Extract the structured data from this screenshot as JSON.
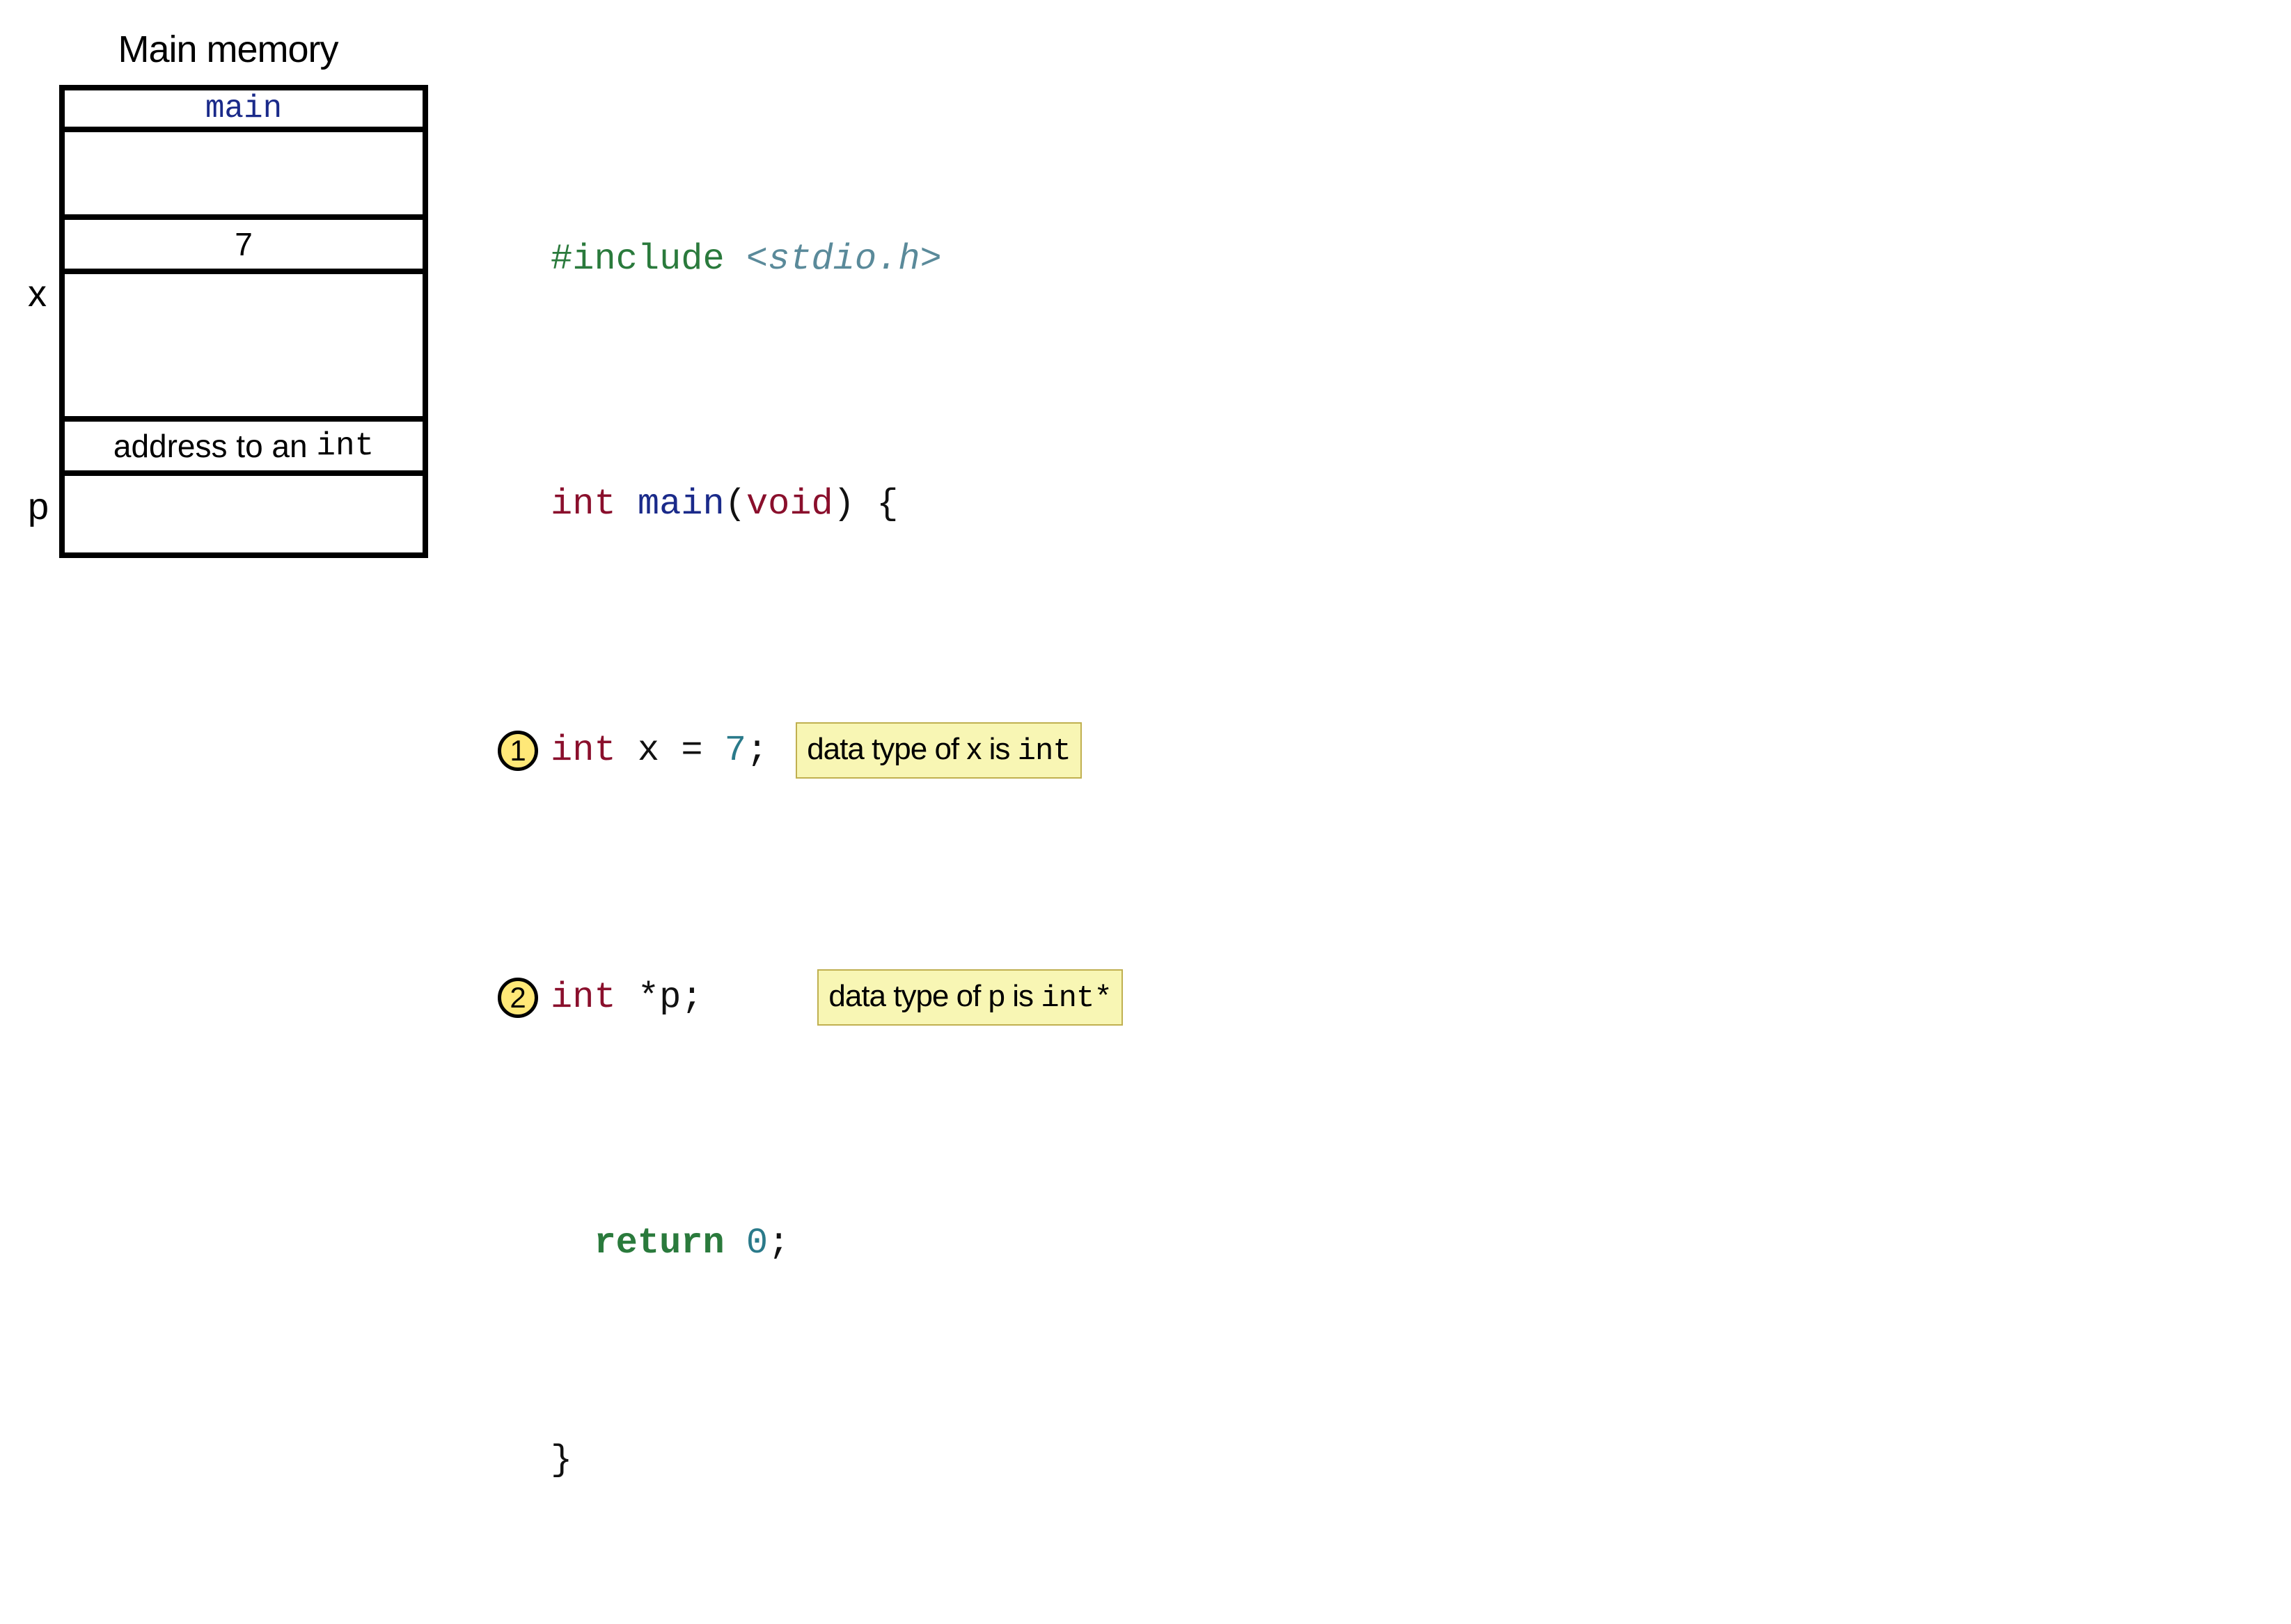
{
  "memory": {
    "title": "Main memory",
    "header": "main",
    "labelX": "x",
    "labelP": "p",
    "valueX": "7",
    "valueP_prefix": "address to an ",
    "valueP_type": "int"
  },
  "code": {
    "include_kw": "#include",
    "include_hdr": "<stdio.h>",
    "type_int": "int",
    "func_main": "main",
    "type_void": "void",
    "brace_open": "{",
    "brace_close": "}",
    "var_x": "x",
    "eq": "=",
    "num_7": "7",
    "semi": ";",
    "star": "*",
    "var_p": "p",
    "return_kw": "return",
    "num_0": "0"
  },
  "steps": {
    "s1": "1",
    "s2": "2"
  },
  "annotations": {
    "a1_prefix": "data type of x is ",
    "a1_type": "int",
    "a2_prefix": "data type of p is ",
    "a2_type": "int*"
  }
}
